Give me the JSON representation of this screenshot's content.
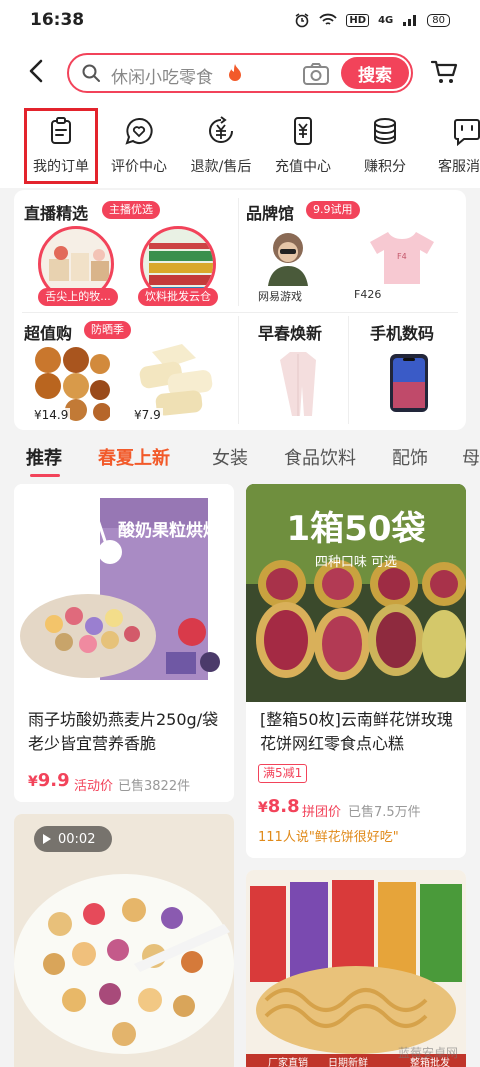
{
  "status": {
    "time": "16:38",
    "network": "4G",
    "battery": "80"
  },
  "search": {
    "placeholder": "休闲小吃零食",
    "button": "搜索"
  },
  "icon_row": [
    {
      "label": "我的订单",
      "icon": "clipboard-icon"
    },
    {
      "label": "评价中心",
      "icon": "heart-chat-icon"
    },
    {
      "label": "退款/售后",
      "icon": "yuan-refund-icon"
    },
    {
      "label": "充值中心",
      "icon": "yuan-phone-icon"
    },
    {
      "label": "赚积分",
      "icon": "coin-stack-icon"
    },
    {
      "label": "客服消",
      "icon": "service-chat-icon"
    }
  ],
  "promo": {
    "live": {
      "title": "直播精选",
      "tag": "主播优选",
      "items": [
        "舌尖上的牧...",
        "饮料批发云仓"
      ]
    },
    "brand": {
      "title": "品牌馆",
      "tag": "9.9试用",
      "items": [
        "网易游戏",
        "F426"
      ]
    },
    "deal": {
      "title": "超值购",
      "tag": "防晒季",
      "prices": [
        "¥14.9",
        "¥7.9"
      ]
    },
    "spring": {
      "title": "早春焕新"
    },
    "digital": {
      "title": "手机数码"
    }
  },
  "tabs": [
    "推荐",
    "春夏上新",
    "女装",
    "食品饮料",
    "配饰",
    "母"
  ],
  "products": [
    {
      "title": "雨子坊酸奶燕麦片250g/袋 老少皆宜营养香脆",
      "image_text": "酸奶果粒烘焙燕麦",
      "price_symbol": "¥",
      "price": "9.9",
      "activity": "活动价",
      "sold": "已售3822件"
    },
    {
      "title": "[整箱50枚]云南鲜花饼玫瑰花饼网红零食点心糕",
      "image_text": "1箱50袋",
      "image_subtext": "四种口味  可选",
      "coupon": "满5减1",
      "price_symbol": "¥",
      "price": "8.8",
      "activity": "拼团价",
      "sold": "已售7.5万件",
      "review": "111人说\"鲜花饼很好吃\""
    },
    {
      "video_duration": "00:02"
    },
    {
      "image_bottom_left": "厂家直销",
      "image_bottom_mid": "日期新鲜",
      "image_bottom_right": "整箱批发"
    }
  ],
  "watermark": "蓝莓安卓网"
}
